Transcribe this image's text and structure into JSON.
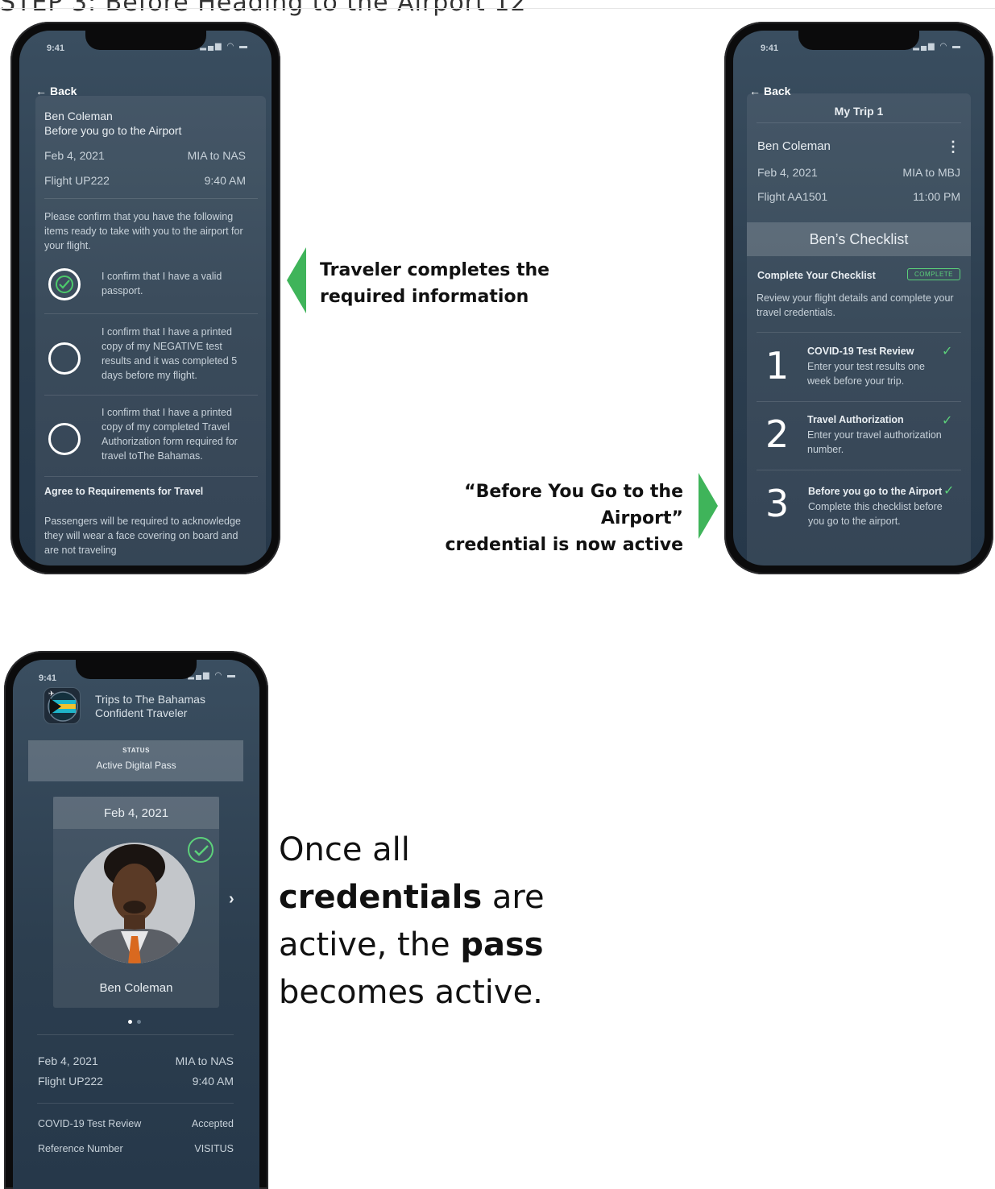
{
  "page": {
    "title": "STEP 3: Before Heading to the Airport 12"
  },
  "status_bar": {
    "time": "9:41",
    "icons": "▂▄▆ ◠ ▬"
  },
  "phone1": {
    "back_label": "Back",
    "name": "Ben Coleman",
    "subtitle": "Before you go to the Airport",
    "date": "Feb 4, 2021",
    "route": "MIA to NAS",
    "flight": "Flight UP222",
    "time": "9:40 AM",
    "intro": "Please confirm that you have the following items ready to take with you to the airport for your flight.",
    "items": [
      {
        "text": "I confirm that I have a valid passport.",
        "checked": true
      },
      {
        "text": "I confirm that I have a printed copy of my NEGATIVE test results and it was completed 5 days before my flight.",
        "checked": false
      },
      {
        "text": "I confirm that I have a printed copy of my completed Travel Authorization form required for travel toThe Bahamas.",
        "checked": false
      }
    ],
    "section_title": "Agree to Requirements for Travel",
    "section_text": "Passengers will be required to acknowledge they will wear a face covering on board and are not traveling"
  },
  "callout1": {
    "line1": "Traveler completes the",
    "line2": "required information"
  },
  "callout2": {
    "line1": "“Before You Go to the Airport”",
    "line2": "credential is now active"
  },
  "phone2": {
    "back_label": "Back",
    "trip_title": "My Trip 1",
    "name": "Ben Coleman",
    "menu_icon": "⋮",
    "date": "Feb 4, 2021",
    "route": "MIA to MBJ",
    "flight": "Flight AA1501",
    "time": "11:00 PM",
    "checklist_title": "Ben’s Checklist",
    "complete_heading": "Complete Your Checklist",
    "complete_badge": "COMPLETE",
    "complete_desc": "Review your flight details and complete your travel credentials.",
    "steps": [
      {
        "num": "1",
        "title": "COVID-19 Test Review",
        "desc": "Enter your test results one week before your trip."
      },
      {
        "num": "2",
        "title": "Travel Authorization",
        "desc": "Enter your travel authorization number."
      },
      {
        "num": "3",
        "title": "Before you go to the Airport",
        "desc": "Complete this checklist before you go to the airport."
      }
    ]
  },
  "phone3": {
    "app_line1": "Trips to The Bahamas",
    "app_line2": "Confident Traveler",
    "status_label": "STATUS",
    "status_value": "Active Digital Pass",
    "pass_date": "Feb 4, 2021",
    "pass_name": "Ben Coleman",
    "chevron": "›",
    "date": "Feb 4, 2021",
    "route": "MIA to NAS",
    "flight": "Flight UP222",
    "time": "9:40 AM",
    "rows": [
      {
        "label": "COVID-19 Test Review",
        "value": "Accepted"
      },
      {
        "label": "Reference Number",
        "value": "VISITUS"
      }
    ]
  },
  "bigtext": {
    "line1": "Once all",
    "line2_bold": "credentials",
    "line2_rest": " are",
    "line3_start": "active, the ",
    "line3_bold": "pass",
    "line4": "becomes active."
  },
  "colors": {
    "accent_green": "#3fb45a",
    "check_green": "#5cd17a",
    "screen_bg": "#2c3e4f"
  }
}
